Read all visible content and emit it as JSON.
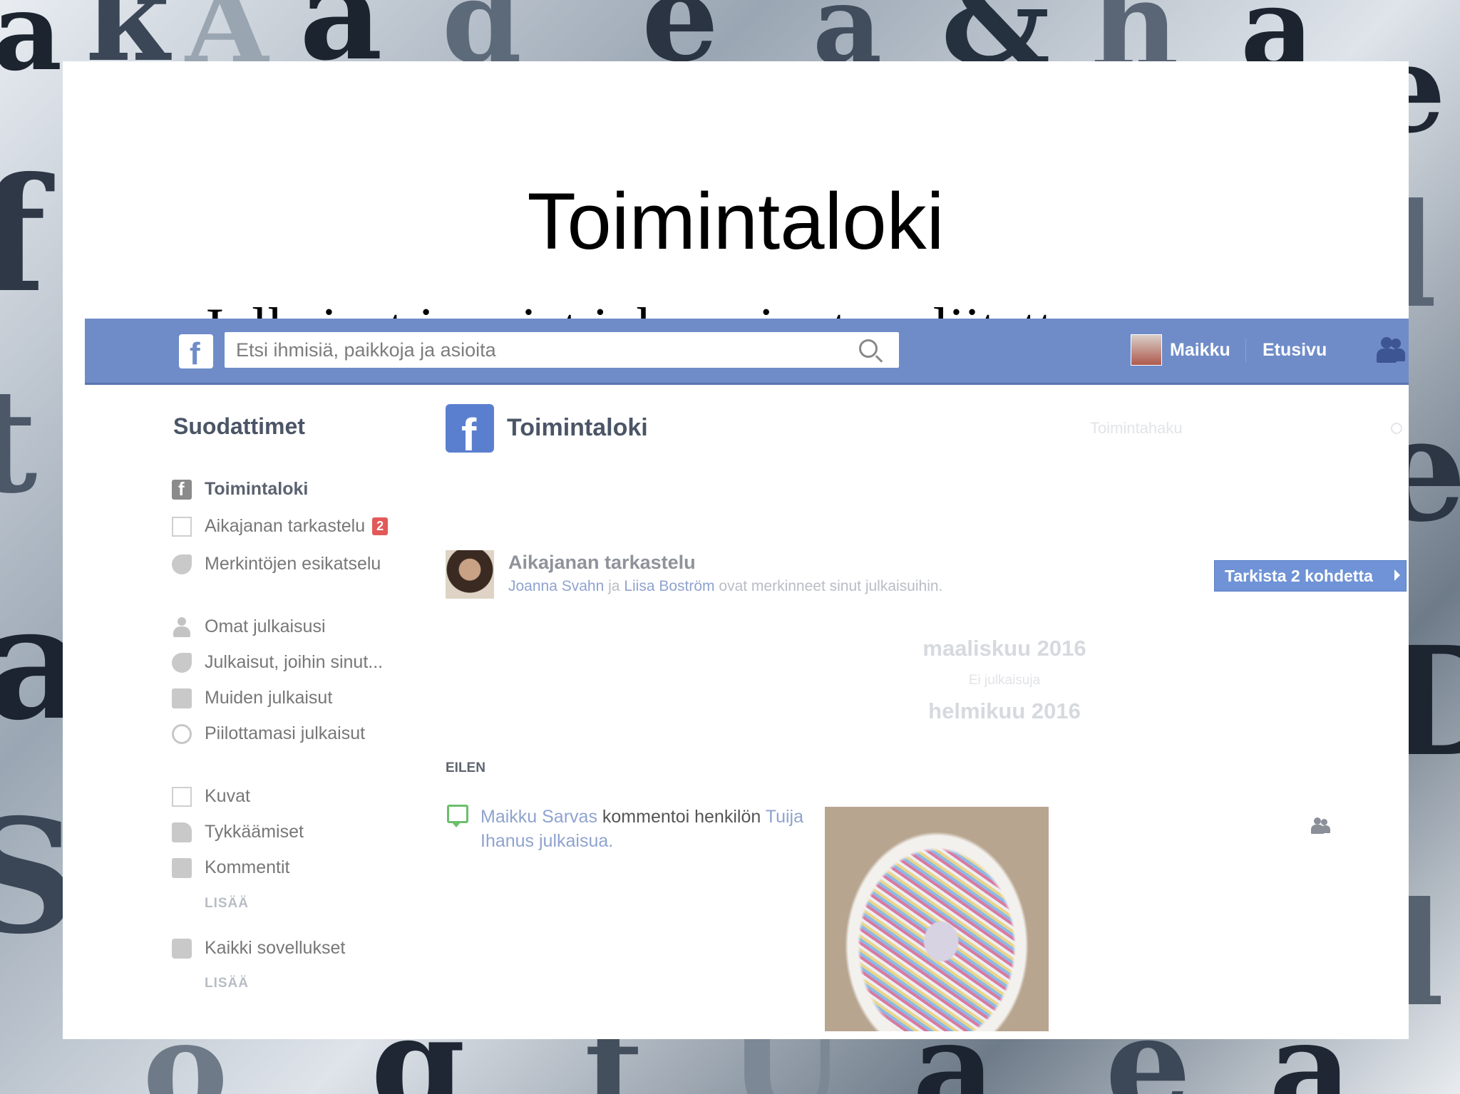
{
  "slide": {
    "title": "Toimintaloki",
    "bullet": "Julkaisut ja asiat johon sinut on liitetty"
  },
  "topbar": {
    "search_placeholder": "Etsi ihmisiä, paikkoja ja asioita",
    "user_name": "Maikku",
    "home_label": "Etusivu"
  },
  "sidebar": {
    "title": "Suodattimet",
    "items": [
      {
        "label": "Toimintaloki",
        "icon": "facebook-icon"
      },
      {
        "label": "Aikajanan tarkastelu",
        "icon": "timeline-icon",
        "badge": "2"
      },
      {
        "label": "Merkintöjen esikatselu",
        "icon": "tag-icon"
      },
      {
        "label": "Omat julkaisusi",
        "icon": "person-icon"
      },
      {
        "label": "Julkaisut, joihin sinut...",
        "icon": "tag-icon"
      },
      {
        "label": "Muiden julkaisut",
        "icon": "chat-icon"
      },
      {
        "label": "Piilottamasi julkaisut",
        "icon": "hidden-icon"
      },
      {
        "label": "Kuvat",
        "icon": "photos-icon"
      },
      {
        "label": "Tykkäämiset",
        "icon": "like-icon"
      },
      {
        "label": "Kommentit",
        "icon": "comment-icon"
      },
      {
        "label": "Kaikki sovellukset",
        "icon": "apps-icon"
      }
    ],
    "more_label": "LISÄÄ"
  },
  "main": {
    "title": "Toimintaloki",
    "search_placeholder": "Toimintahaku",
    "review": {
      "title": "Aikajanan tarkastelu",
      "person1": "Joanna Svahn",
      "and": "ja",
      "person2": "Liisa Boström",
      "rest": "ovat merkinneet sinut julkaisuihin.",
      "button": "Tarkista 2 kohdetta"
    },
    "month1": "maaliskuu 2016",
    "no_posts": "Ei julkaisuja",
    "month2": "helmikuu 2016",
    "section": "EILEN",
    "activity": {
      "actor": "Maikku Sarvas",
      "verb": "kommentoi henkilön",
      "target": "Tuija Ihanus julkaisua."
    }
  },
  "colors": {
    "fb_blue": "#6f8cc9",
    "bullet": "#19857f",
    "badge": "#e25959",
    "button": "#6f93d6"
  }
}
